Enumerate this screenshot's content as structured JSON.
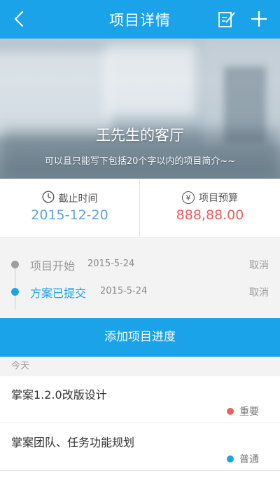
{
  "header": {
    "title": "项目详情",
    "back_icon": "chevron-left-icon",
    "edit_icon": "edit-icon",
    "add_icon": "plus-icon",
    "color": "#1aa3e8"
  },
  "banner": {
    "title": "王先生的客厅",
    "subtitle": "可以且只能写下包括20个字以内的项目简介~~"
  },
  "stats": {
    "deadline": {
      "icon": "clock-icon",
      "label": "截止时间",
      "value": "2015-12-20",
      "color": "#5aa7de"
    },
    "budget": {
      "icon": "yen-icon",
      "label": "项目预算",
      "value": "888,88.00",
      "color": "#ee5f5b"
    }
  },
  "timeline": [
    {
      "name": "项目开始",
      "date": "2015-5-24",
      "action": "取消",
      "dot_color": "#9e9e9e",
      "text_color": "#999999"
    },
    {
      "name": "方案已提交",
      "date": "2015-5-24",
      "action": "取消",
      "dot_color": "#1aa3e8",
      "text_color": "#1aa3e8"
    }
  ],
  "add_progress_label": "添加项目进度",
  "day_label": "今天",
  "tasks": [
    {
      "title": "掌案1.2.0改版设计",
      "tag": "重要",
      "tag_color": "#ee5f5b"
    },
    {
      "title": "掌案团队、任务功能规划",
      "tag": "普通",
      "tag_color": "#1aa3e8"
    }
  ]
}
